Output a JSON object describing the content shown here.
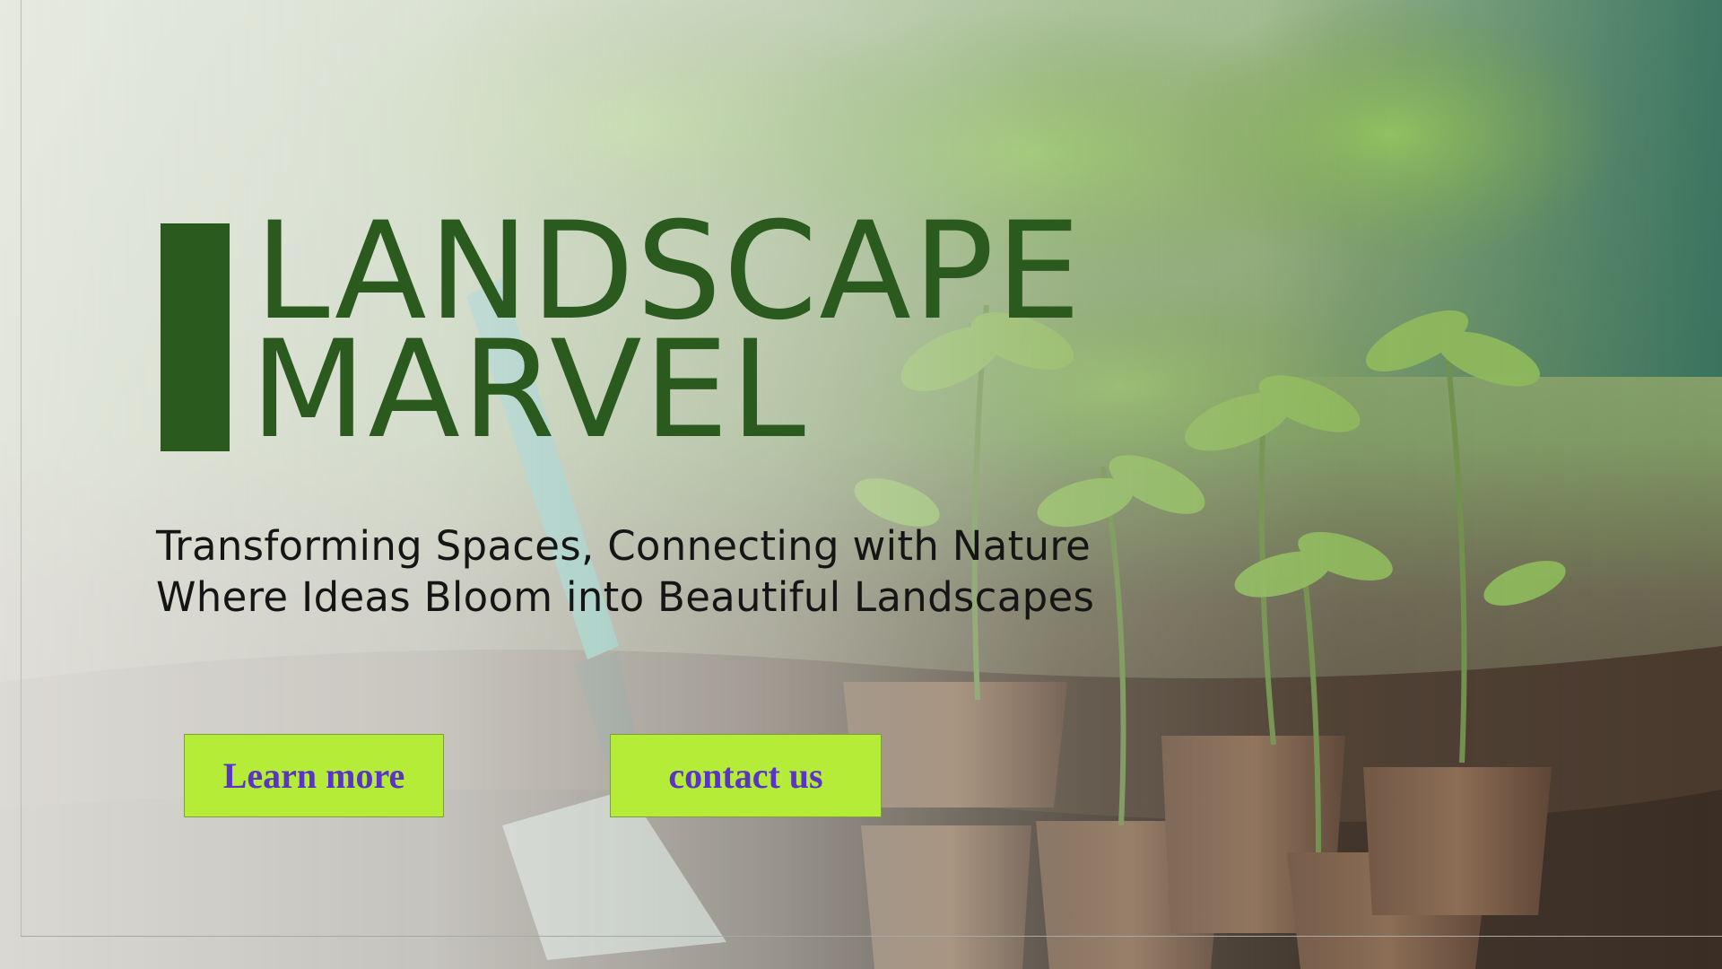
{
  "hero": {
    "title_line_1": "LANDSCAPE",
    "title_line_2": "MARVEL",
    "tagline_line_1": "Transforming Spaces, Connecting with Nature",
    "tagline_line_2": "Where Ideas Bloom into Beautiful Landscapes"
  },
  "buttons": {
    "learn_more": "Learn more",
    "contact_us": "contact us"
  },
  "colors": {
    "title_green": "#2a5a1e",
    "button_bg": "#b5ec37",
    "button_text": "#5b34c7"
  }
}
